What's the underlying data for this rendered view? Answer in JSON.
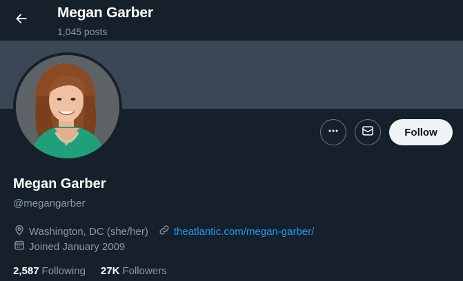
{
  "header": {
    "title": "Megan Garber",
    "posts_count": "1,045 posts",
    "back_icon": "arrow-left-icon"
  },
  "profile": {
    "name": "Megan Garber",
    "handle": "@megangarber",
    "location": "Washington, DC (she/her)",
    "website": "theatlantic.com/megan-garber/",
    "joined": "Joined January 2009"
  },
  "actions": {
    "more_icon": "more-dots-icon",
    "message_icon": "envelope-icon",
    "follow_label": "Follow"
  },
  "stats": {
    "following_count": "2,587",
    "following_label": "Following",
    "followers_count": "27K",
    "followers_label": "Followers"
  },
  "colors": {
    "background": "#15202b",
    "banner": "#3b4754",
    "link": "#1d9bf0",
    "secondary_text": "#8b98a5",
    "follow_button_bg": "#eff3f4"
  }
}
